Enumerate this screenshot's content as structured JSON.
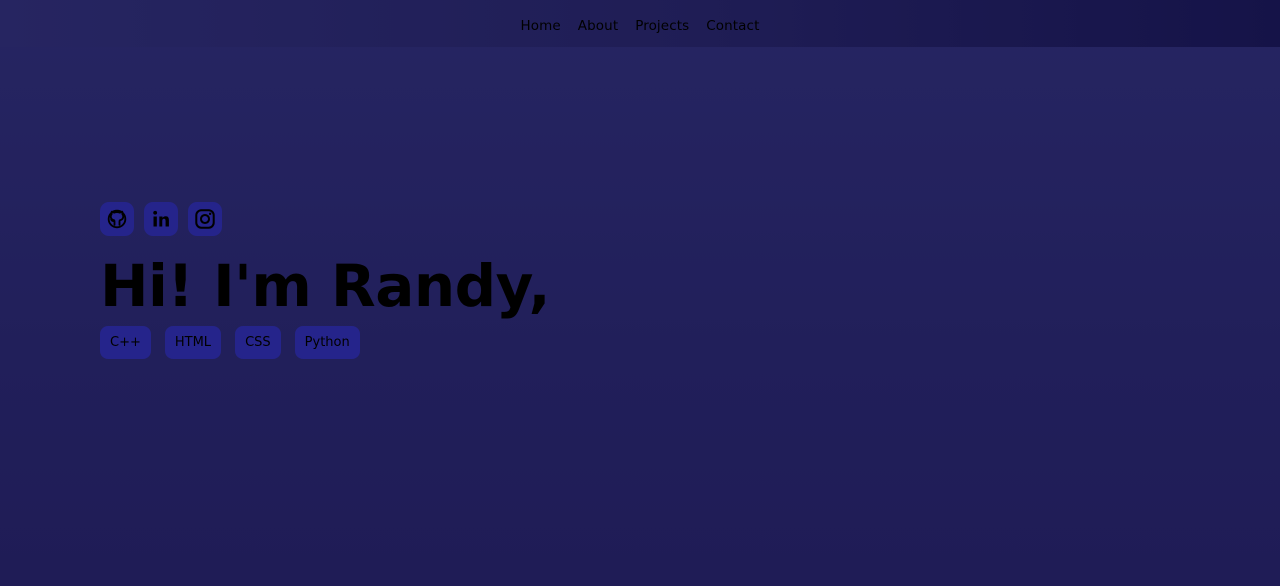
{
  "nav": {
    "links": [
      {
        "label": "Home"
      },
      {
        "label": "About"
      },
      {
        "label": "Projects"
      },
      {
        "label": "Contact"
      }
    ]
  },
  "hero": {
    "title": "Hi! I'm Randy,",
    "socials": [
      {
        "icon": "github-icon"
      },
      {
        "icon": "linkedin-icon"
      },
      {
        "icon": "instagram-icon"
      }
    ],
    "skills": [
      "C++",
      "HTML",
      "CSS",
      "Python"
    ]
  },
  "colors": {
    "background": "#221f5b",
    "navbar": "#1f1d55",
    "badge": "#25248b",
    "text": "#000000"
  }
}
